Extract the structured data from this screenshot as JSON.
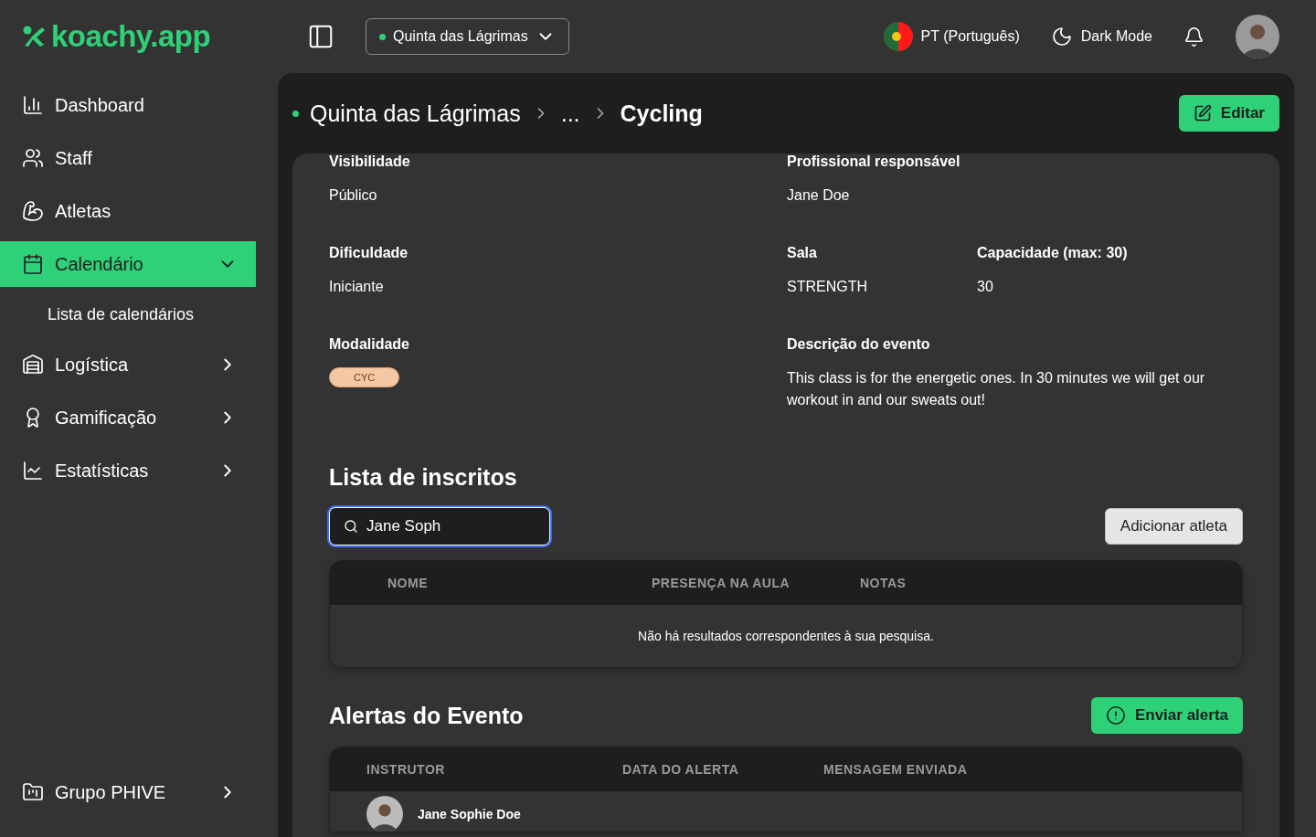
{
  "brand": {
    "name": "koachy.app"
  },
  "header": {
    "location": {
      "name": "Quinta das Lágrimas",
      "active": true
    },
    "language": "PT (Português)",
    "theme_toggle": "Dark Mode"
  },
  "sidebar": {
    "items": [
      {
        "label": "Dashboard",
        "kind": "link",
        "selected": false
      },
      {
        "label": "Staff",
        "kind": "link",
        "selected": false
      },
      {
        "label": "Atletas",
        "kind": "link",
        "selected": false
      },
      {
        "label": "Calendário",
        "kind": "group",
        "selected": true,
        "expanded": true,
        "children": [
          {
            "label": "Lista de calendários",
            "selected": false
          }
        ]
      },
      {
        "label": "Logística",
        "kind": "group",
        "selected": false,
        "expanded": false
      },
      {
        "label": "Gamificação",
        "kind": "group",
        "selected": false,
        "expanded": false
      },
      {
        "label": "Estatísticas",
        "kind": "group",
        "selected": false,
        "expanded": false
      }
    ],
    "footer": {
      "label": "Grupo PHIVE",
      "kind": "group",
      "expanded": false
    }
  },
  "breadcrumb": [
    "Quinta das Lágrimas",
    "...",
    "Cycling"
  ],
  "edit_button": "Editar",
  "details": {
    "rows": [
      [
        {
          "label": "Visibilidade",
          "value": "Público",
          "kind": "text"
        },
        {
          "label": "Profissional responsável",
          "value": "Jane Doe",
          "kind": "text"
        }
      ],
      [
        {
          "label": "Dificuldade",
          "value": "Iniciante",
          "kind": "text"
        },
        {
          "label": "Sala",
          "value": "STRENGTH",
          "kind": "text"
        },
        {
          "label": "Capacidade (max: 30)",
          "value": "30",
          "kind": "text"
        }
      ],
      [
        {
          "label": "Modalidade",
          "value": "CYC",
          "kind": "tag",
          "color": "#f4c8a4"
        },
        {
          "label": "Descrição do evento",
          "value": "This class is for the energetic ones. In 30 minutes we will get our workout in and our sweats out!",
          "kind": "text"
        }
      ]
    ]
  },
  "enrolled": {
    "title": "Lista de inscritos",
    "search": {
      "value": "Jane Soph",
      "focused": true
    },
    "add_button": "Adicionar atleta",
    "columns": [
      "NOME",
      "PRESENÇA NA AULA",
      "NOTAS"
    ],
    "empty_message": "Não há resultados correspondentes à sua pesquisa."
  },
  "alerts": {
    "title": "Alertas do Evento",
    "send_button": "Enviar alerta",
    "columns": [
      "INSTRUTOR",
      "DATA DO ALERTA",
      "MENSAGEM ENVIADA"
    ],
    "rows": [
      {
        "instructor": "Jane Sophie Doe"
      }
    ]
  }
}
